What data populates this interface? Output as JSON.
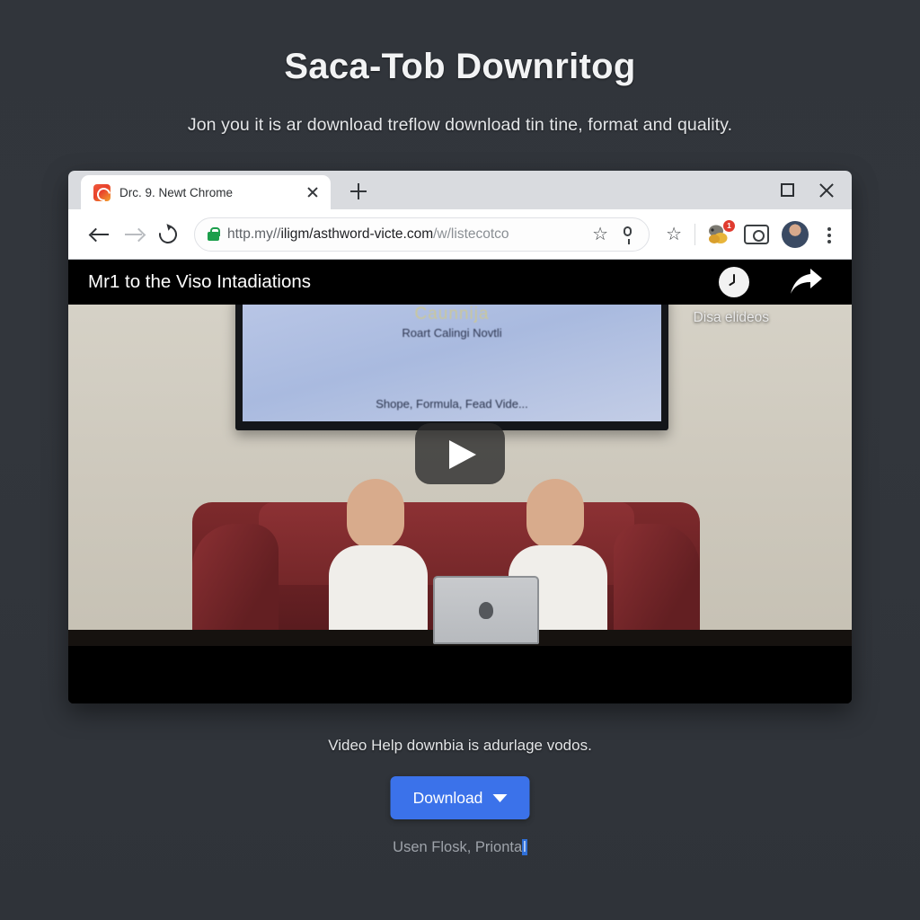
{
  "hero": {
    "title": "Saca-Tob Downritog",
    "subtitle": "Jon you it is ar download treflow download tin tine, format and quality."
  },
  "browser": {
    "tab": {
      "title": "Drc. 9. Newt Chrome",
      "favicon": "swirl-favicon",
      "close_label": "",
      "newtab_label": ""
    },
    "window_controls": {
      "maximize": "maximize-icon",
      "close": "close-icon"
    },
    "toolbar": {
      "back": "back-arrow-icon",
      "forward": "forward-arrow-icon",
      "reload": "reload-icon",
      "lock": "secure-lock-icon",
      "url_scheme": "http.my//",
      "url_host": "iligm/asthword-victe.com",
      "url_path": "/w/listecotco",
      "bookmark_star": "☆",
      "mic": "mic-icon",
      "saved_star": "☆",
      "extension_badge": "1",
      "camera": "screenshot-icon",
      "avatar": "profile-avatar",
      "menu": "kebab-menu-icon"
    }
  },
  "video": {
    "title": "Mr1 to the Viso Intadiations",
    "watch_later": "clock-icon",
    "share": "share-arrow-icon",
    "action_label": "Disa elideos",
    "play": "play-button",
    "screen_text": {
      "line1": "Caunnija",
      "line2": "Roart Calingi Novtli",
      "line3": "Shope, Formula, Fead Vide..."
    }
  },
  "footer": {
    "caption": "Video Help downbia is adurlage vodos.",
    "download_label": "Download",
    "note_text": "Usen Flosk, Prionta",
    "note_highlight": "l"
  },
  "colors": {
    "background": "#31353b",
    "accent_blue": "#3b72ea",
    "lock_green": "#1b9e4b",
    "badge_red": "#e03b2f"
  }
}
